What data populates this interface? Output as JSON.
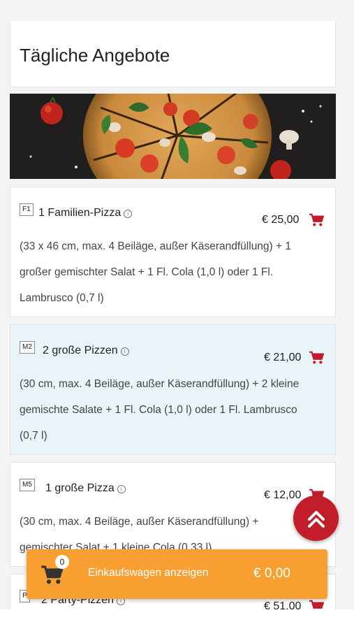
{
  "section": {
    "title": "Tägliche Angebote"
  },
  "items": [
    {
      "code": "F1",
      "name": "1 Familien-Pizza",
      "price": "€ 25,00",
      "desc_lines": [
        "(33 x 46 cm, max. 4 Beiläge, außer Käserandfüllung) + 1",
        "großer gemischter Salat + 1 Fl. Cola (1,0 l) oder 1 Fl.",
        "Lambrusco (0,7 l)"
      ]
    },
    {
      "code": "M2",
      "name": "2 große Pizzen",
      "price": "€ 21,00",
      "desc_lines": [
        "(30 cm, max. 4 Beiläge, außer Käserandfüllung) + 2 kleine",
        "gemischte Salate + 1 Fl. Cola (1,0 l) oder 1 Fl. Lambrusco",
        "(0,7 l)"
      ]
    },
    {
      "code": "M5",
      "name": "1 große Pizza",
      "price": "€ 12,00",
      "desc_lines": [
        "(30 cm, max. 4 Beiläge, außer Käserandfüllung) +",
        "gemischter Salat + 1 kleine Cola (0,33 l)"
      ]
    },
    {
      "code": "P",
      "name": "2 Party-Pizzen",
      "price": "€ 51,00"
    }
  ],
  "cart": {
    "count": "0",
    "label": "Einkaufswagen anzeigen",
    "total": "€ 0,00"
  },
  "icons": {
    "cart": "shopping-cart-icon",
    "info": "info-icon",
    "scroll_top": "double-chevron-up-icon"
  },
  "colors": {
    "accent_red": "#c21d2a",
    "cart_bar_orange": "#f7a031",
    "highlight_bg": "#e8f4f8"
  }
}
